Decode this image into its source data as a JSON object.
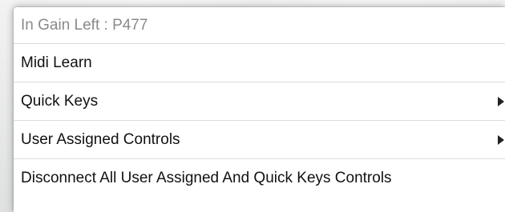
{
  "menu": {
    "header_label": "In Gain Left : P477",
    "items": [
      {
        "label": "Midi Learn",
        "has_submenu": false
      },
      {
        "label": "Quick Keys",
        "has_submenu": true,
        "icon": "chevron-right-icon"
      },
      {
        "label": "User Assigned Controls",
        "has_submenu": true,
        "icon": "chevron-right-icon"
      },
      {
        "label": "Disconnect All User Assigned And Quick Keys Controls",
        "has_submenu": false
      }
    ]
  },
  "colors": {
    "menu_background": "#ffffff",
    "text": "#111111",
    "header_text": "#8a8a8a",
    "separator": "#dcdcdc"
  }
}
